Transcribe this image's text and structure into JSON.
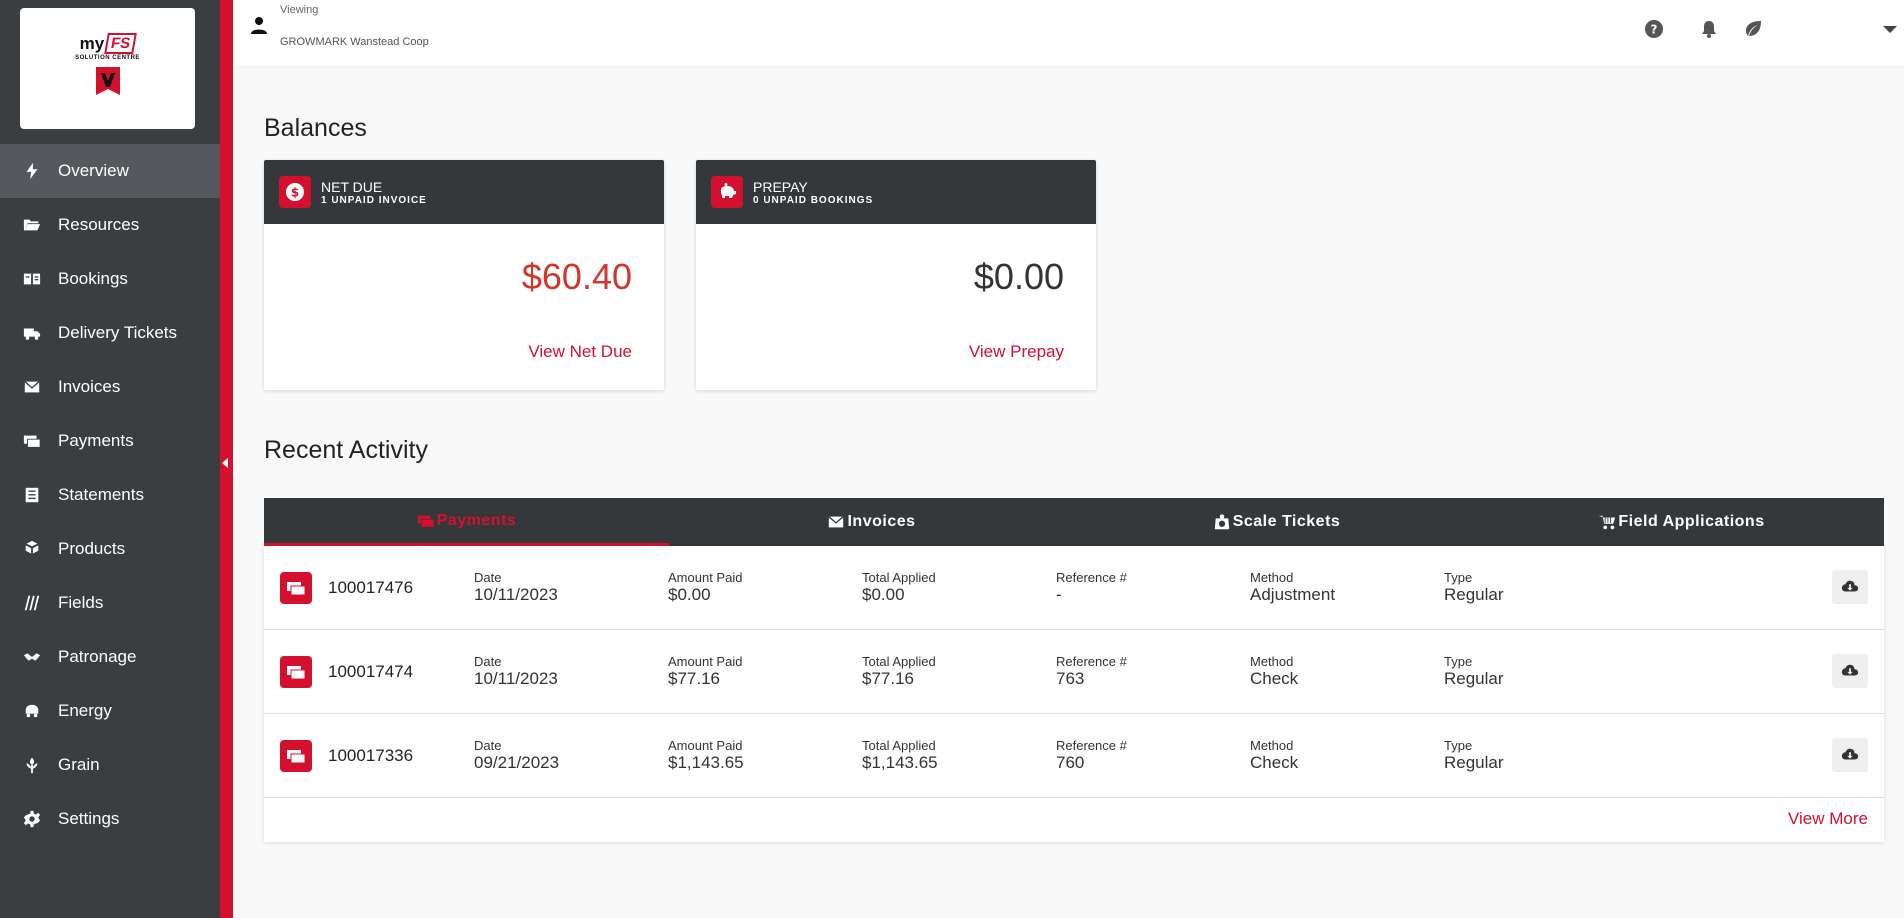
{
  "header": {
    "viewing_label": "Viewing",
    "account_name": "GROWMARK Wanstead Coop",
    "icons": [
      "user-icon",
      "help-icon",
      "bell-icon",
      "leaf-icon",
      "chevron-down-icon"
    ]
  },
  "logo": {
    "my": "my",
    "fs": "FS",
    "subtitle": "SOLUTION CENTRE"
  },
  "sidebar": {
    "items": [
      {
        "label": "Overview",
        "icon": "bolt-icon",
        "active": true
      },
      {
        "label": "Resources",
        "icon": "folder-icon"
      },
      {
        "label": "Bookings",
        "icon": "book-icon"
      },
      {
        "label": "Delivery Tickets",
        "icon": "truck-icon"
      },
      {
        "label": "Invoices",
        "icon": "envelope-icon"
      },
      {
        "label": "Payments",
        "icon": "payment-icon"
      },
      {
        "label": "Statements",
        "icon": "statement-icon"
      },
      {
        "label": "Products",
        "icon": "boxes-icon"
      },
      {
        "label": "Fields",
        "icon": "field-icon"
      },
      {
        "label": "Patronage",
        "icon": "handshake-icon"
      },
      {
        "label": "Energy",
        "icon": "energy-icon"
      },
      {
        "label": "Grain",
        "icon": "grain-icon"
      },
      {
        "label": "Settings",
        "icon": "gear-icon"
      }
    ]
  },
  "balances": {
    "title": "Balances",
    "net_due": {
      "title": "NET DUE",
      "subtitle": "1 UNPAID INVOICE",
      "amount": "$60.40",
      "link": "View Net Due",
      "amount_color": "#d4352b"
    },
    "prepay": {
      "title": "PREPAY",
      "subtitle": "0 UNPAID BOOKINGS",
      "amount": "$0.00",
      "link": "View Prepay",
      "amount_color": "#333333"
    }
  },
  "recent_activity": {
    "title": "Recent Activity",
    "tabs": [
      {
        "label": "Payments",
        "icon": "payment-icon",
        "active": true
      },
      {
        "label": "Invoices",
        "icon": "envelope-icon"
      },
      {
        "label": "Scale Tickets",
        "icon": "scale-icon"
      },
      {
        "label": "Field Applications",
        "icon": "sprayer-icon"
      }
    ],
    "columns": {
      "date": "Date",
      "amount_paid": "Amount Paid",
      "total_applied": "Total Applied",
      "reference": "Reference #",
      "method": "Method",
      "type": "Type"
    },
    "rows": [
      {
        "id": "100017476",
        "date": "10/11/2023",
        "amount_paid": "$0.00",
        "total_applied": "$0.00",
        "reference": "-",
        "method": "Adjustment",
        "type": "Regular"
      },
      {
        "id": "100017474",
        "date": "10/11/2023",
        "amount_paid": "$77.16",
        "total_applied": "$77.16",
        "reference": "763",
        "method": "Check",
        "type": "Regular"
      },
      {
        "id": "100017336",
        "date": "09/21/2023",
        "amount_paid": "$1,143.65",
        "total_applied": "$1,143.65",
        "reference": "760",
        "method": "Check",
        "type": "Regular"
      }
    ],
    "view_more": "View More"
  },
  "colors": {
    "brand_red": "#d4102f",
    "sidebar": "#3b3e41",
    "card_header": "#35383b"
  }
}
